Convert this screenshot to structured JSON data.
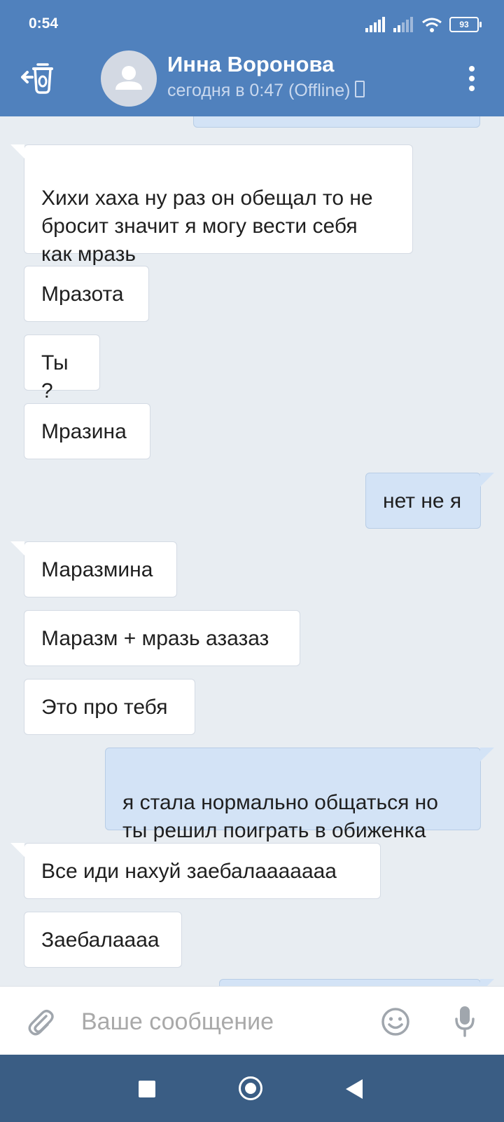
{
  "status_bar": {
    "time": "0:54",
    "battery": "93"
  },
  "header": {
    "contact_name": "Инна Воронова",
    "last_seen": "сегодня в 0:47 (Offline)"
  },
  "messages": [
    {
      "text": "Хихи хаха ну раз он обещал то не\nбросит значит я могу вести себя\nкак мразь",
      "direction": "incoming"
    },
    {
      "text": "Мразота",
      "direction": "incoming"
    },
    {
      "text": "Ты ?",
      "direction": "incoming"
    },
    {
      "text": "Мразина",
      "direction": "incoming"
    },
    {
      "text": "нет не я",
      "direction": "outgoing"
    },
    {
      "text": "Маразмина",
      "direction": "incoming"
    },
    {
      "text": "Маразм + мразь азазаз",
      "direction": "incoming"
    },
    {
      "text": "Это про тебя",
      "direction": "incoming"
    },
    {
      "text": "я стала нормально общаться но\nты решил поиграть в обиженка",
      "direction": "outgoing"
    },
    {
      "text": "Все иди нахуй заебалааааааа",
      "direction": "incoming"
    },
    {
      "text": "Заебалаааа",
      "direction": "incoming"
    }
  ],
  "composer": {
    "placeholder": "Ваше сообщение"
  },
  "colors": {
    "header": "#5081bd",
    "incoming_bubble": "#ffffff",
    "outgoing_bubble": "#d3e3f6",
    "chat_background": "#e8edf2",
    "navbar": "#3a5d84"
  }
}
